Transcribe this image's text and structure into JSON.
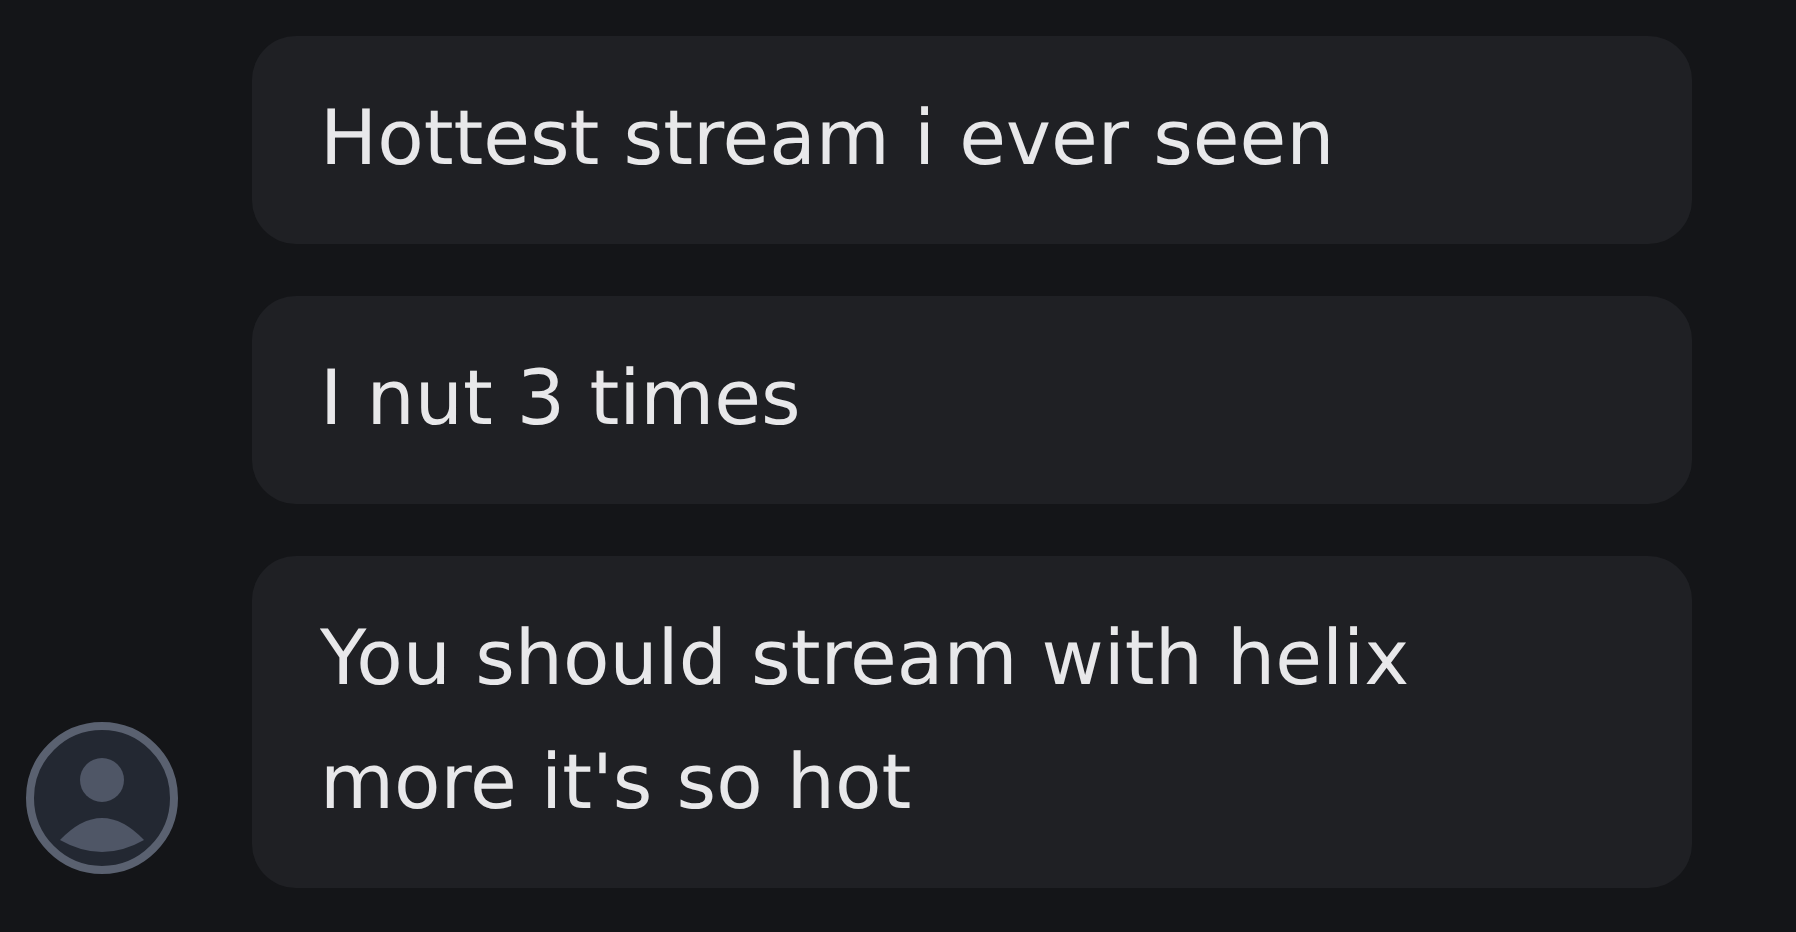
{
  "messages": [
    {
      "text": "Hottest stream i ever seen"
    },
    {
      "text": "I nut 3 times"
    },
    {
      "text": "You should stream with helix more it's so hot"
    }
  ]
}
